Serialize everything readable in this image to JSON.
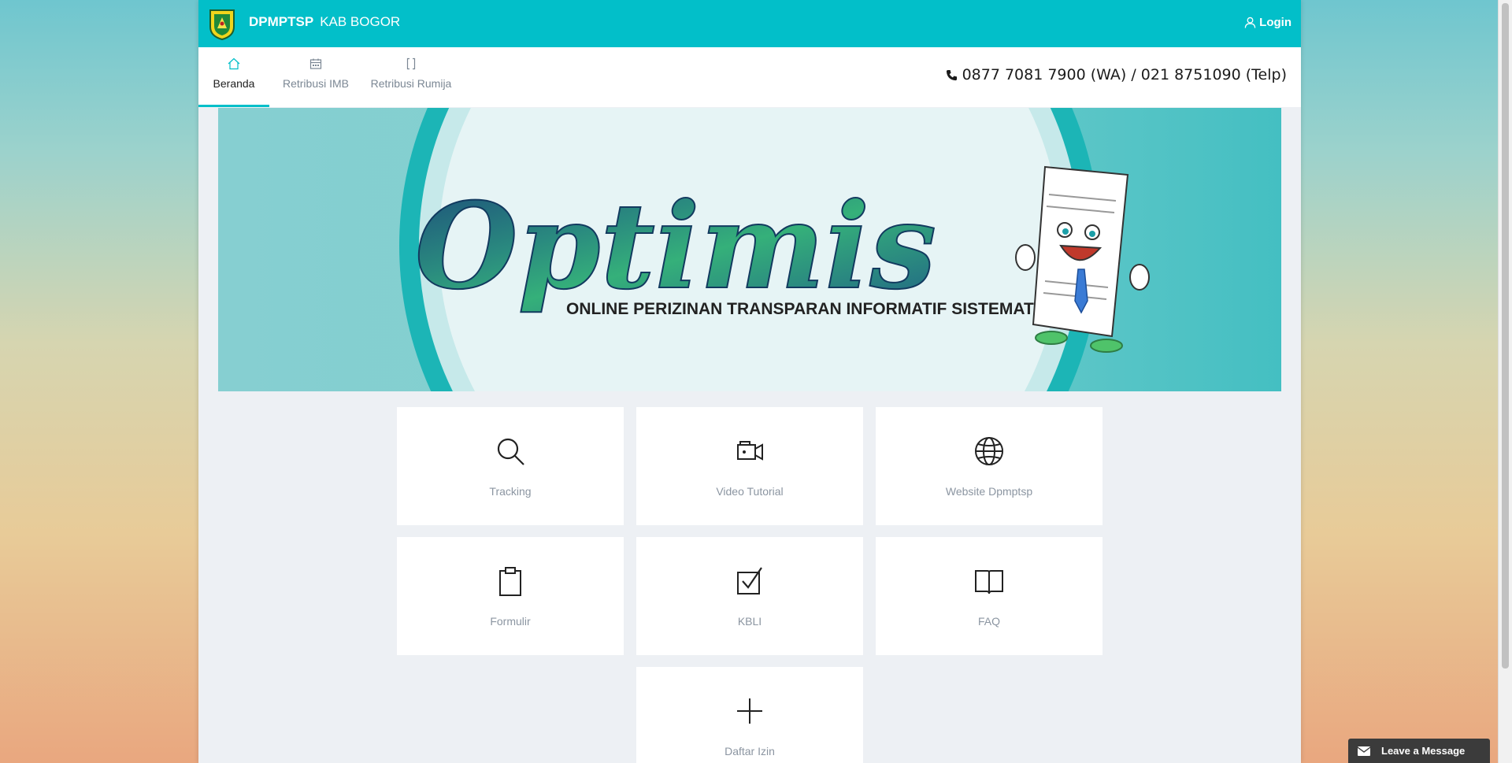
{
  "header": {
    "brand_bold": "DPMPTSP",
    "brand_regular": "KAB BOGOR",
    "login_label": "Login"
  },
  "nav": {
    "tabs": [
      {
        "label": "Beranda",
        "icon": "home-icon",
        "active": true
      },
      {
        "label": "Retribusi IMB",
        "icon": "calendar-icon",
        "active": false
      },
      {
        "label": "Retribusi Rumija",
        "icon": "bracket-icon",
        "active": false
      }
    ],
    "phone": "0877 7081 7900 (WA) / 021 8751090 (Telp)"
  },
  "banner": {
    "logo_text": "Optimis",
    "subtitle": "ONLINE PERIZINAN TRANSPARAN INFORMATIF SISTEMATIS"
  },
  "tiles": [
    {
      "label": "Tracking",
      "icon": "search-icon"
    },
    {
      "label": "Video Tutorial",
      "icon": "video-camera-icon"
    },
    {
      "label": "Website Dpmptsp",
      "icon": "globe-icon"
    },
    {
      "label": "Formulir",
      "icon": "clipboard-icon"
    },
    {
      "label": "KBLI",
      "icon": "checkbox-icon"
    },
    {
      "label": "FAQ",
      "icon": "book-icon"
    },
    {
      "label": "Daftar Izin",
      "icon": "plus-icon"
    }
  ],
  "chat": {
    "label": "Leave a Message",
    "icon": "envelope-icon"
  },
  "colors": {
    "accent": "#02bfc9",
    "banner_bg": "#57c4c6",
    "tile_text": "#8b95a1"
  }
}
